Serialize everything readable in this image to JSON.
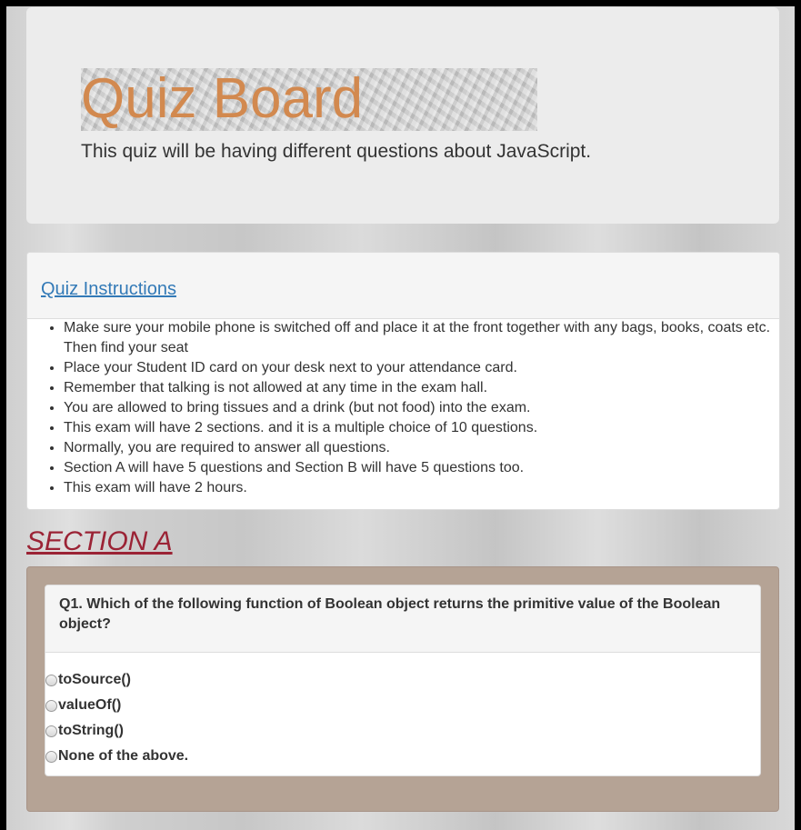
{
  "header": {
    "title": "Quiz Board",
    "subtitle": "This quiz will be having different questions about JavaScript."
  },
  "instructions": {
    "heading": "Quiz Instructions",
    "items": [
      "Make sure your mobile phone is switched off and place it at the front together with any bags, books, coats etc. Then find your seat",
      "Place your Student ID card on your desk next to your attendance card.",
      "Remember that talking is not allowed at any time in the exam hall.",
      "You are allowed to bring tissues and a drink (but not food) into the exam.",
      "This exam will have 2 sections. and it is a multiple choice of 10 questions.",
      "Normally, you are required to answer all questions.",
      "Section A will have 5 questions and Section B will have 5 questions too.",
      "This exam will have 2 hours."
    ]
  },
  "section": {
    "title": "SECTION A"
  },
  "question1": {
    "text": "Q1. Which of the following function of Boolean object returns the primitive value of the Boolean object?",
    "options": [
      "toSource()",
      "valueOf()",
      "toString()",
      "None of the above."
    ]
  },
  "colors": {
    "title": "#d2894f",
    "link": "#337ab7",
    "section_title": "#9b2335",
    "question_card": "#b5a395"
  }
}
